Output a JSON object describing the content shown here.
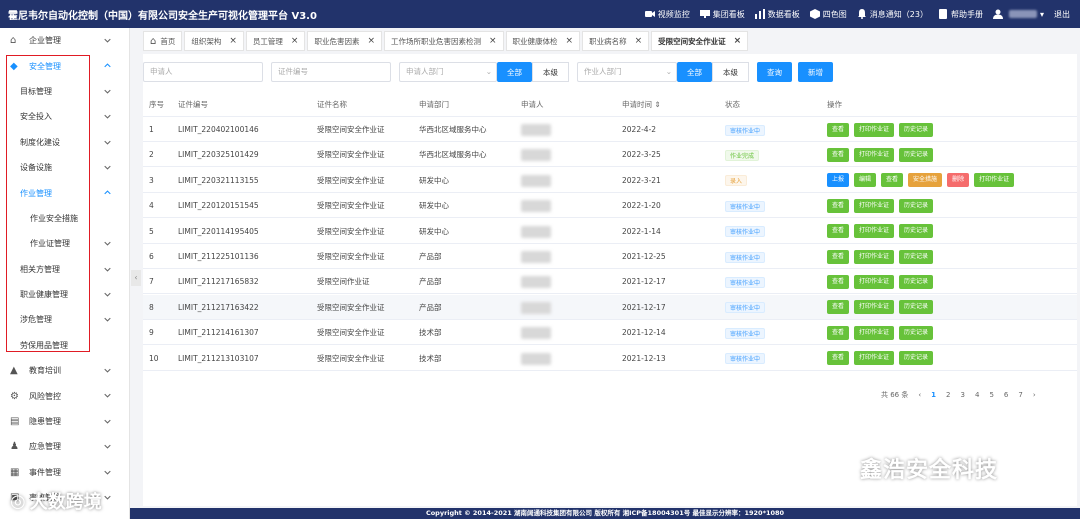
{
  "app_title": "霍尼韦尔自动化控制（中国）有限公司安全生产可视化管理平台  V3.0",
  "topnav": [
    {
      "label": "视频监控",
      "icon": "video-icon"
    },
    {
      "label": "集团看板",
      "icon": "monitor-icon"
    },
    {
      "label": "数据看板",
      "icon": "chart-icon"
    },
    {
      "label": "四色图",
      "icon": "cube-icon"
    },
    {
      "label": "消息通知（23）",
      "icon": "bell-icon"
    },
    {
      "label": "帮助手册",
      "icon": "book-icon"
    },
    {
      "label": "",
      "icon": "user-icon"
    },
    {
      "label": "退出",
      "icon": "logout-icon"
    }
  ],
  "sidebar": [
    {
      "label": "企业管理",
      "level": 0,
      "icon": "building-icon",
      "chevron": "down"
    },
    {
      "label": "安全管理",
      "level": 0,
      "icon": "shield-icon",
      "chevron": "up",
      "active": true
    },
    {
      "label": "目标管理",
      "level": 1,
      "chevron": "down"
    },
    {
      "label": "安全投入",
      "level": 1,
      "chevron": "down"
    },
    {
      "label": "制度化建设",
      "level": 1,
      "chevron": "down"
    },
    {
      "label": "设备设施",
      "level": 1,
      "chevron": "down"
    },
    {
      "label": "作业管理",
      "level": 1,
      "chevron": "up",
      "active": true
    },
    {
      "label": "作业安全措施",
      "level": 2,
      "chevron": ""
    },
    {
      "label": "作业证管理",
      "level": 2,
      "chevron": "down"
    },
    {
      "label": "相关方管理",
      "level": 1,
      "chevron": "down"
    },
    {
      "label": "职业健康管理",
      "level": 1,
      "chevron": "down"
    },
    {
      "label": "涉危管理",
      "level": 1,
      "chevron": "down"
    },
    {
      "label": "劳保用品管理",
      "level": 1,
      "chevron": ""
    },
    {
      "label": "教育培训",
      "level": 0,
      "icon": "graduation-icon",
      "chevron": "down"
    },
    {
      "label": "风险管控",
      "level": 0,
      "icon": "settings-icon",
      "chevron": "down"
    },
    {
      "label": "隐患管理",
      "level": 0,
      "icon": "desk-icon",
      "chevron": "down"
    },
    {
      "label": "应急管理",
      "level": 0,
      "icon": "person-icon",
      "chevron": "down"
    },
    {
      "label": "事件管理",
      "level": 0,
      "icon": "document-icon",
      "chevron": "down"
    },
    {
      "label": "事故管理",
      "level": 0,
      "icon": "folder-icon",
      "chevron": "down"
    }
  ],
  "tabs": [
    {
      "label": "首页",
      "icon": "home-icon",
      "closable": false
    },
    {
      "label": "组织架构",
      "closable": true
    },
    {
      "label": "员工管理",
      "closable": true
    },
    {
      "label": "职业危害因素",
      "closable": true
    },
    {
      "label": "工作场所职业危害因素检测",
      "closable": true
    },
    {
      "label": "职业健康体检",
      "closable": true
    },
    {
      "label": "职业病名称",
      "closable": true
    },
    {
      "label": "受限空间安全作业证",
      "closable": true,
      "active": true
    }
  ],
  "filters": {
    "applicant_placeholder": "申请人",
    "cert_no_placeholder": "证件编号",
    "dept_placeholder": "申请人部门",
    "btn_all": "全部",
    "btn_level": "本级",
    "dept2_placeholder": "作业人部门",
    "btn_all2": "全部",
    "btn_level2": "本级",
    "btn_query": "查询",
    "btn_add": "新增"
  },
  "table": {
    "headers": [
      "序号",
      "证件编号",
      "证件名称",
      "申请部门",
      "申请人",
      "申请时间 ⇕",
      "状态",
      "操作"
    ],
    "rows": [
      {
        "no": "1",
        "code": "LIMIT_220402100146",
        "name": "受限空间安全作业证",
        "dept": "华西北区域服务中心",
        "date": "2022-4-2",
        "status": "审核作业中",
        "status_color": "blue",
        "ops": [
          [
            "查看",
            "g"
          ],
          [
            "打印作业证",
            "g"
          ],
          [
            "历史记录",
            "g"
          ]
        ]
      },
      {
        "no": "2",
        "code": "LIMIT_220325101429",
        "name": "受限空间安全作业证",
        "dept": "华西北区域服务中心",
        "date": "2022-3-25",
        "status": "作业完成",
        "status_color": "green",
        "ops": [
          [
            "查看",
            "g"
          ],
          [
            "打印作业证",
            "g"
          ],
          [
            "历史记录",
            "g"
          ]
        ]
      },
      {
        "no": "3",
        "code": "LIMIT_220321113155",
        "name": "受限空间安全作业证",
        "dept": "研发中心",
        "date": "2022-3-21",
        "status": "录入",
        "status_color": "orange",
        "ops": [
          [
            "上报",
            "b"
          ],
          [
            "编辑",
            "g"
          ],
          [
            "查看",
            "g"
          ],
          [
            "安全措施",
            "o"
          ],
          [
            "删除",
            "r"
          ],
          [
            "打印作业证",
            "g"
          ]
        ]
      },
      {
        "no": "4",
        "code": "LIMIT_220120151545",
        "name": "受限空间安全作业证",
        "dept": "研发中心",
        "date": "2022-1-20",
        "status": "审核作业中",
        "status_color": "blue",
        "ops": [
          [
            "查看",
            "g"
          ],
          [
            "打印作业证",
            "g"
          ],
          [
            "历史记录",
            "g"
          ]
        ]
      },
      {
        "no": "5",
        "code": "LIMIT_220114195405",
        "name": "受限空间安全作业证",
        "dept": "研发中心",
        "date": "2022-1-14",
        "status": "审核作业中",
        "status_color": "blue",
        "ops": [
          [
            "查看",
            "g"
          ],
          [
            "打印作业证",
            "g"
          ],
          [
            "历史记录",
            "g"
          ]
        ]
      },
      {
        "no": "6",
        "code": "LIMIT_211225101136",
        "name": "受限空间安全作业证",
        "dept": "产品部",
        "date": "2021-12-25",
        "status": "审核作业中",
        "status_color": "blue",
        "ops": [
          [
            "查看",
            "g"
          ],
          [
            "打印作业证",
            "g"
          ],
          [
            "历史记录",
            "g"
          ]
        ]
      },
      {
        "no": "7",
        "code": "LIMIT_211217165832",
        "name": "受限空间作业证",
        "dept": "产品部",
        "date": "2021-12-17",
        "status": "审核作业中",
        "status_color": "blue",
        "ops": [
          [
            "查看",
            "g"
          ],
          [
            "打印作业证",
            "g"
          ],
          [
            "历史记录",
            "g"
          ]
        ]
      },
      {
        "no": "8",
        "code": "LIMIT_211217163422",
        "name": "受限空间安全作业证",
        "dept": "产品部",
        "date": "2021-12-17",
        "status": "审核作业中",
        "status_color": "blue",
        "ops": [
          [
            "查看",
            "g"
          ],
          [
            "打印作业证",
            "g"
          ],
          [
            "历史记录",
            "g"
          ]
        ]
      },
      {
        "no": "9",
        "code": "LIMIT_211214161307",
        "name": "受限空间安全作业证",
        "dept": "技术部",
        "date": "2021-12-14",
        "status": "审核作业中",
        "status_color": "blue",
        "ops": [
          [
            "查看",
            "g"
          ],
          [
            "打印作业证",
            "g"
          ],
          [
            "历史记录",
            "g"
          ]
        ]
      },
      {
        "no": "10",
        "code": "LIMIT_211213103107",
        "name": "受限空间安全作业证",
        "dept": "技术部",
        "date": "2021-12-13",
        "status": "审核作业中",
        "status_color": "blue",
        "ops": [
          [
            "查看",
            "g"
          ],
          [
            "打印作业证",
            "g"
          ],
          [
            "历史记录",
            "g"
          ]
        ]
      }
    ]
  },
  "pagination": {
    "total": "共 66 条",
    "prev": "‹",
    "pages": [
      "1",
      "2",
      "3",
      "4",
      "5",
      "6",
      "7"
    ],
    "current": "1",
    "next": "›"
  },
  "footer": "Copyright © 2014-2021 湖南阔通科技集团有限公司 版权所有 湘ICP备18004301号  最佳显示分辨率：1920*1080",
  "watermark_right": "鑫浩安全科技",
  "watermark_left": "大数跨境",
  "colors": {
    "topbar": "#22336b",
    "primary": "#1890ff",
    "success": "#67c23a",
    "warning": "#e6a23c",
    "danger": "#f56c6c",
    "highlight_box": "#e01b24"
  }
}
